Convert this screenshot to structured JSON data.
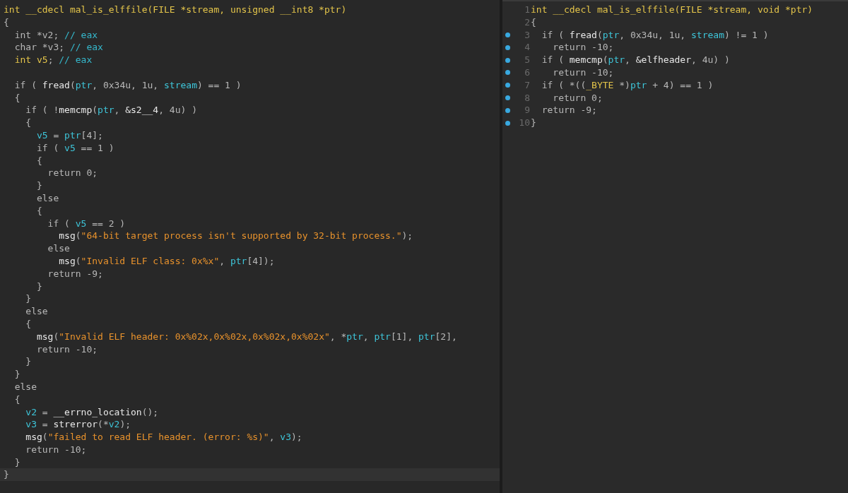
{
  "left": {
    "lines": [
      {
        "kind": "code",
        "tokens": [
          {
            "kind": "sig",
            "text": "int __cdecl mal_is_elffile(FILE *stream, unsigned __int8 *ptr)"
          }
        ]
      },
      {
        "kind": "code",
        "tokens": [
          {
            "kind": "p",
            "text": "{"
          }
        ]
      },
      {
        "kind": "code",
        "tokens": [
          {
            "kind": "p",
            "text": "  int *v2; "
          },
          {
            "kind": "cm",
            "text": "// eax"
          }
        ]
      },
      {
        "kind": "code",
        "tokens": [
          {
            "kind": "p",
            "text": "  char *v3; "
          },
          {
            "kind": "cm",
            "text": "// eax"
          }
        ]
      },
      {
        "kind": "code",
        "tokens": [
          {
            "kind": "sig",
            "text": "  int v5"
          },
          {
            "kind": "p",
            "text": "; "
          },
          {
            "kind": "cm",
            "text": "// eax"
          }
        ]
      },
      {
        "kind": "blank"
      },
      {
        "kind": "code",
        "tokens": [
          {
            "kind": "p",
            "text": "  if ( "
          },
          {
            "kind": "fn",
            "text": "fread"
          },
          {
            "kind": "p",
            "text": "("
          },
          {
            "kind": "var",
            "text": "ptr"
          },
          {
            "kind": "p",
            "text": ", 0x34u, 1u, "
          },
          {
            "kind": "var",
            "text": "stream"
          },
          {
            "kind": "p",
            "text": ") == 1 )"
          }
        ]
      },
      {
        "kind": "code",
        "tokens": [
          {
            "kind": "p",
            "text": "  {"
          }
        ]
      },
      {
        "kind": "code",
        "tokens": [
          {
            "kind": "p",
            "text": "    if ( !"
          },
          {
            "kind": "fn",
            "text": "memcmp"
          },
          {
            "kind": "p",
            "text": "("
          },
          {
            "kind": "var",
            "text": "ptr"
          },
          {
            "kind": "p",
            "text": ", "
          },
          {
            "kind": "fn",
            "text": "&s2__4"
          },
          {
            "kind": "p",
            "text": ", 4u) )"
          }
        ]
      },
      {
        "kind": "code",
        "tokens": [
          {
            "kind": "p",
            "text": "    {"
          }
        ]
      },
      {
        "kind": "code",
        "tokens": [
          {
            "kind": "var",
            "text": "      v5"
          },
          {
            "kind": "p",
            "text": " = "
          },
          {
            "kind": "var",
            "text": "ptr"
          },
          {
            "kind": "p",
            "text": "[4];"
          }
        ]
      },
      {
        "kind": "code",
        "tokens": [
          {
            "kind": "p",
            "text": "      if ( "
          },
          {
            "kind": "var",
            "text": "v5"
          },
          {
            "kind": "p",
            "text": " == 1 )"
          }
        ]
      },
      {
        "kind": "code",
        "tokens": [
          {
            "kind": "p",
            "text": "      {"
          }
        ]
      },
      {
        "kind": "code",
        "tokens": [
          {
            "kind": "p",
            "text": "        return 0;"
          }
        ]
      },
      {
        "kind": "code",
        "tokens": [
          {
            "kind": "p",
            "text": "      }"
          }
        ]
      },
      {
        "kind": "code",
        "tokens": [
          {
            "kind": "p",
            "text": "      else"
          }
        ]
      },
      {
        "kind": "code",
        "tokens": [
          {
            "kind": "p",
            "text": "      {"
          }
        ]
      },
      {
        "kind": "code",
        "tokens": [
          {
            "kind": "p",
            "text": "        if ( "
          },
          {
            "kind": "var",
            "text": "v5"
          },
          {
            "kind": "p",
            "text": " == 2 )"
          }
        ]
      },
      {
        "kind": "code",
        "tokens": [
          {
            "kind": "fn",
            "text": "          msg"
          },
          {
            "kind": "p",
            "text": "("
          },
          {
            "kind": "str",
            "text": "\"64-bit target process isn't supported by 32-bit process.\""
          },
          {
            "kind": "p",
            "text": ");"
          }
        ]
      },
      {
        "kind": "code",
        "tokens": [
          {
            "kind": "p",
            "text": "        else"
          }
        ]
      },
      {
        "kind": "code",
        "tokens": [
          {
            "kind": "fn",
            "text": "          msg"
          },
          {
            "kind": "p",
            "text": "("
          },
          {
            "kind": "str",
            "text": "\"Invalid ELF class: 0x%x\""
          },
          {
            "kind": "p",
            "text": ", "
          },
          {
            "kind": "var",
            "text": "ptr"
          },
          {
            "kind": "p",
            "text": "[4]);"
          }
        ]
      },
      {
        "kind": "code",
        "tokens": [
          {
            "kind": "p",
            "text": "        return -9;"
          }
        ]
      },
      {
        "kind": "code",
        "tokens": [
          {
            "kind": "p",
            "text": "      }"
          }
        ]
      },
      {
        "kind": "code",
        "tokens": [
          {
            "kind": "p",
            "text": "    }"
          }
        ]
      },
      {
        "kind": "code",
        "tokens": [
          {
            "kind": "p",
            "text": "    else"
          }
        ]
      },
      {
        "kind": "code",
        "tokens": [
          {
            "kind": "p",
            "text": "    {"
          }
        ]
      },
      {
        "kind": "code",
        "tokens": [
          {
            "kind": "fn",
            "text": "      msg"
          },
          {
            "kind": "p",
            "text": "("
          },
          {
            "kind": "str",
            "text": "\"Invalid ELF header: 0x%02x,0x%02x,0x%02x,0x%02x\""
          },
          {
            "kind": "p",
            "text": ", *"
          },
          {
            "kind": "var",
            "text": "ptr"
          },
          {
            "kind": "p",
            "text": ", "
          },
          {
            "kind": "var",
            "text": "ptr"
          },
          {
            "kind": "p",
            "text": "[1], "
          },
          {
            "kind": "var",
            "text": "ptr"
          },
          {
            "kind": "p",
            "text": "[2],"
          }
        ]
      },
      {
        "kind": "code",
        "tokens": [
          {
            "kind": "p",
            "text": "      return -10;"
          }
        ]
      },
      {
        "kind": "code",
        "tokens": [
          {
            "kind": "p",
            "text": "    }"
          }
        ]
      },
      {
        "kind": "code",
        "tokens": [
          {
            "kind": "p",
            "text": "  }"
          }
        ]
      },
      {
        "kind": "code",
        "tokens": [
          {
            "kind": "p",
            "text": "  else"
          }
        ]
      },
      {
        "kind": "code",
        "tokens": [
          {
            "kind": "p",
            "text": "  {"
          }
        ]
      },
      {
        "kind": "code",
        "tokens": [
          {
            "kind": "var",
            "text": "    v2"
          },
          {
            "kind": "p",
            "text": " = "
          },
          {
            "kind": "fn",
            "text": "__errno_location"
          },
          {
            "kind": "p",
            "text": "();"
          }
        ]
      },
      {
        "kind": "code",
        "tokens": [
          {
            "kind": "var",
            "text": "    v3"
          },
          {
            "kind": "p",
            "text": " = "
          },
          {
            "kind": "fn",
            "text": "strerror"
          },
          {
            "kind": "p",
            "text": "(*"
          },
          {
            "kind": "var",
            "text": "v2"
          },
          {
            "kind": "p",
            "text": ");"
          }
        ]
      },
      {
        "kind": "code",
        "tokens": [
          {
            "kind": "fn",
            "text": "    msg"
          },
          {
            "kind": "p",
            "text": "("
          },
          {
            "kind": "str",
            "text": "\"failed to read ELF header. (error: %s)\""
          },
          {
            "kind": "p",
            "text": ", "
          },
          {
            "kind": "var",
            "text": "v3"
          },
          {
            "kind": "p",
            "text": ");"
          }
        ]
      },
      {
        "kind": "code",
        "tokens": [
          {
            "kind": "p",
            "text": "    return -10;"
          }
        ]
      },
      {
        "kind": "code",
        "tokens": [
          {
            "kind": "p",
            "text": "  }"
          }
        ]
      },
      {
        "kind": "current",
        "tokens": [
          {
            "kind": "p",
            "text": "}"
          }
        ]
      }
    ]
  },
  "right": {
    "lines": [
      {
        "n": "1",
        "breakpoint": false,
        "tokens": [
          {
            "kind": "sig",
            "text": "int __cdecl mal_is_elffile(FILE *stream, void *ptr)"
          }
        ]
      },
      {
        "n": "2",
        "breakpoint": false,
        "tokens": [
          {
            "kind": "p",
            "text": "{"
          }
        ]
      },
      {
        "n": "3",
        "breakpoint": true,
        "tokens": [
          {
            "kind": "p",
            "text": "  if ( "
          },
          {
            "kind": "fn",
            "text": "fread"
          },
          {
            "kind": "p",
            "text": "("
          },
          {
            "kind": "var",
            "text": "ptr"
          },
          {
            "kind": "p",
            "text": ", 0x34u, 1u, "
          },
          {
            "kind": "var",
            "text": "stream"
          },
          {
            "kind": "p",
            "text": ") != 1 )"
          }
        ]
      },
      {
        "n": "4",
        "breakpoint": true,
        "tokens": [
          {
            "kind": "p",
            "text": "    return -10;"
          }
        ]
      },
      {
        "n": "5",
        "breakpoint": true,
        "tokens": [
          {
            "kind": "p",
            "text": "  if ( "
          },
          {
            "kind": "fn",
            "text": "memcmp"
          },
          {
            "kind": "p",
            "text": "("
          },
          {
            "kind": "var",
            "text": "ptr"
          },
          {
            "kind": "p",
            "text": ", "
          },
          {
            "kind": "fn",
            "text": "&elfheader"
          },
          {
            "kind": "p",
            "text": ", 4u) )"
          }
        ]
      },
      {
        "n": "6",
        "breakpoint": true,
        "tokens": [
          {
            "kind": "p",
            "text": "    return -10;"
          }
        ]
      },
      {
        "n": "7",
        "breakpoint": true,
        "tokens": [
          {
            "kind": "p",
            "text": "  if ( *(("
          },
          {
            "kind": "sig",
            "text": "_BYTE"
          },
          {
            "kind": "p",
            "text": " *)"
          },
          {
            "kind": "var",
            "text": "ptr"
          },
          {
            "kind": "p",
            "text": " + 4) == 1 )"
          }
        ]
      },
      {
        "n": "8",
        "breakpoint": true,
        "tokens": [
          {
            "kind": "p",
            "text": "    return 0;"
          }
        ]
      },
      {
        "n": "9",
        "breakpoint": true,
        "tokens": [
          {
            "kind": "p",
            "text": "  return -9;"
          }
        ]
      },
      {
        "n": "10",
        "breakpoint": true,
        "tokens": [
          {
            "kind": "p",
            "text": "}"
          }
        ]
      }
    ]
  }
}
